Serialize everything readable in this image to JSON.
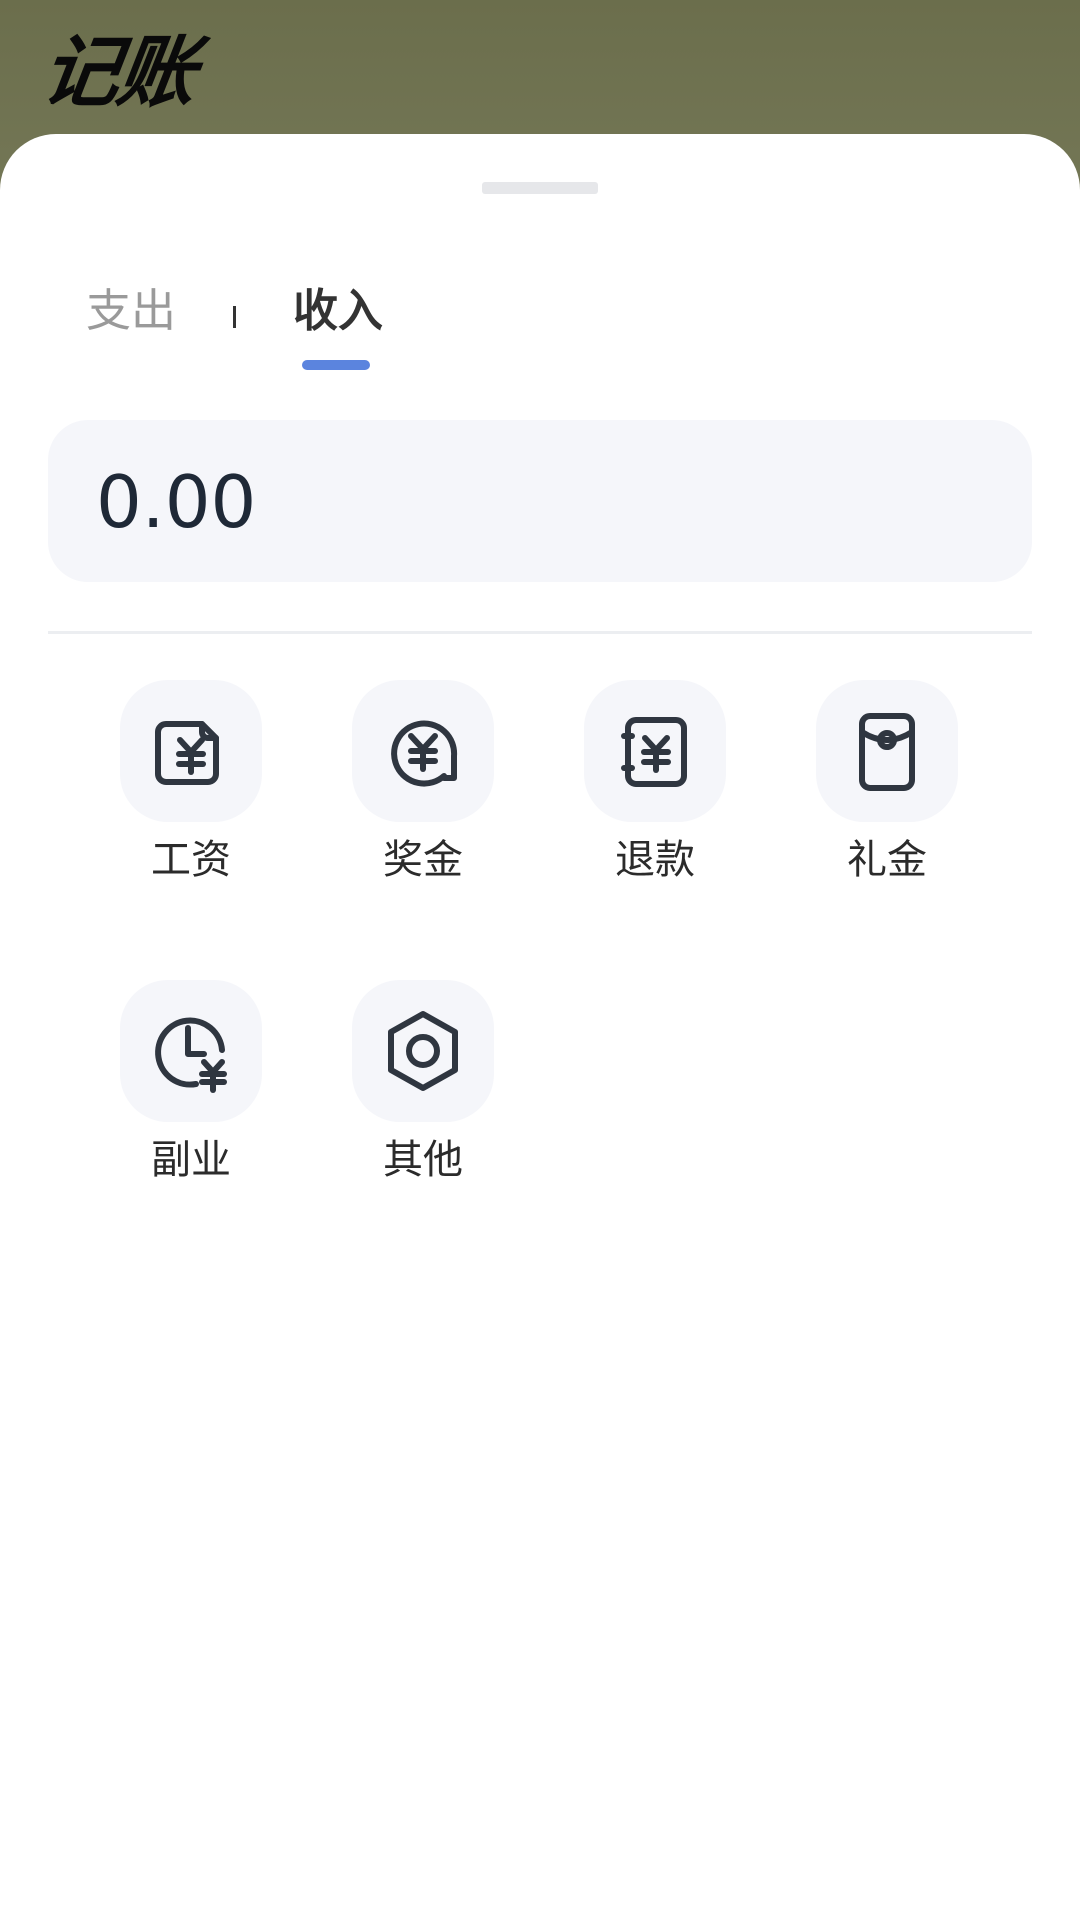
{
  "header": {
    "title": "记账"
  },
  "tabs": {
    "expense_label": "支出",
    "income_label": "收入",
    "active": "income"
  },
  "amount": {
    "value": "0.00"
  },
  "categories": [
    {
      "label": "工资",
      "icon": "salary-icon"
    },
    {
      "label": "奖金",
      "icon": "bonus-icon"
    },
    {
      "label": "退款",
      "icon": "refund-icon"
    },
    {
      "label": "礼金",
      "icon": "gift-money-icon"
    },
    {
      "label": "副业",
      "icon": "side-job-icon"
    },
    {
      "label": "其他",
      "icon": "other-icon"
    }
  ],
  "colors": {
    "accent": "#5b84de",
    "icon_stroke": "#2f3640",
    "backdrop": "#6f7252"
  }
}
